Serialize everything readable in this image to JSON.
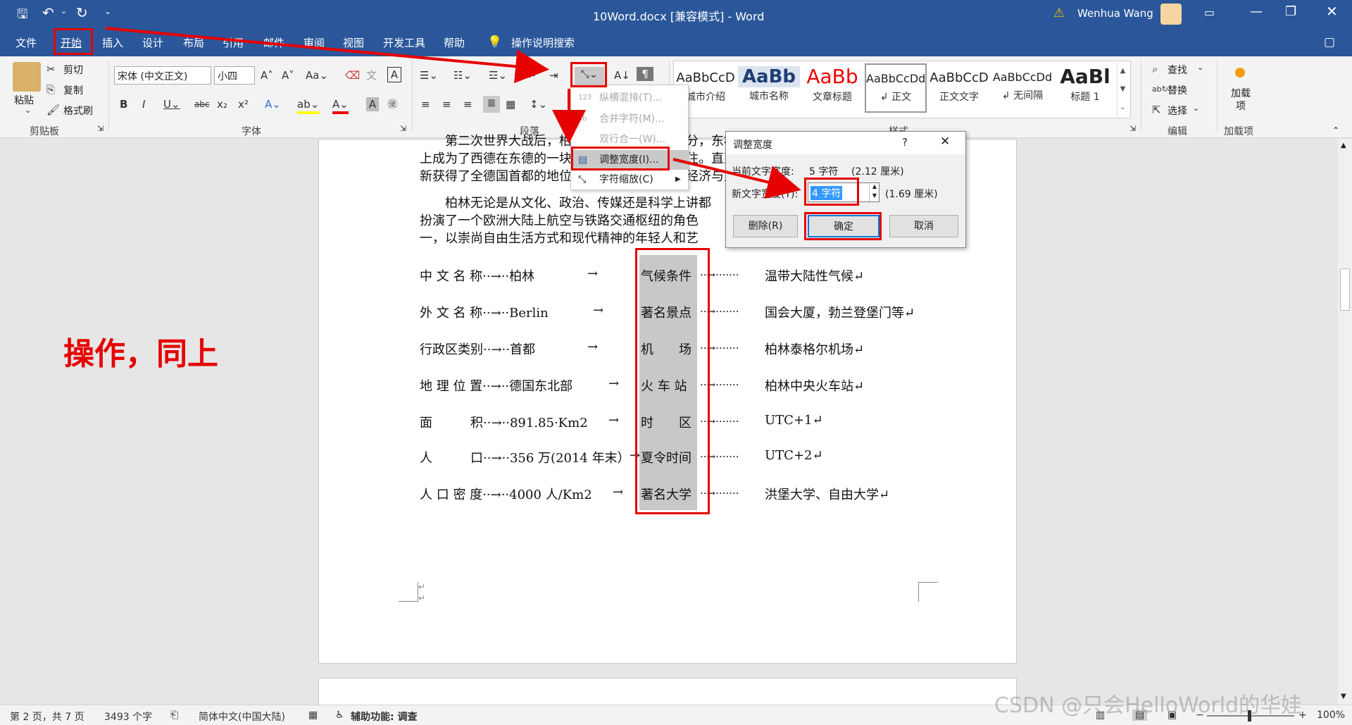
{
  "titlebar": {
    "doc_title": "10Word.docx [兼容模式] - Word",
    "user_name": "Wenhua Wang"
  },
  "tabs": [
    "文件",
    "开始",
    "插入",
    "设计",
    "布局",
    "引用",
    "邮件",
    "审阅",
    "视图",
    "开发工具",
    "帮助"
  ],
  "tell_me": "操作说明搜索",
  "clipboard": {
    "paste": "粘贴",
    "cut": "剪切",
    "copy": "复制",
    "format_painter": "格式刷",
    "group_label": "剪贴板"
  },
  "font": {
    "font_name": "宋体 (中文正文)",
    "font_size": "小四",
    "group_label": "字体"
  },
  "paragraph": {
    "group_label": "段落"
  },
  "styles": {
    "group_label": "样式",
    "items": [
      {
        "preview": "AaBbCcD",
        "name": "城市介绍"
      },
      {
        "preview": "AaBb",
        "name": "城市名称"
      },
      {
        "preview": "AaBb",
        "name": "文章标题"
      },
      {
        "preview": "AaBbCcDd",
        "name": "↲ 正文"
      },
      {
        "preview": "AaBbCcD",
        "name": "正文文字"
      },
      {
        "preview": "AaBbCcDd",
        "name": "↲ 无间隔"
      },
      {
        "preview": "AaBl",
        "name": "标题 1"
      }
    ]
  },
  "editing": {
    "find": "查找",
    "replace": "替换",
    "select": "选择",
    "group_label": "编辑"
  },
  "addins": {
    "label": "加载项",
    "group_label": "加载项"
  },
  "menu": {
    "items": [
      "纵横混排(T)...",
      "合并字符(M)...",
      "双行合一(W)...",
      "调整宽度(I)...",
      "字符缩放(C)"
    ]
  },
  "dialog": {
    "title": "调整宽度",
    "help": "?",
    "current_label": "当前文字宽度:",
    "current_value": "5 字符",
    "current_cm": "(2.12 厘米)",
    "new_label": "新文字宽度(T):",
    "new_value": "4 字符",
    "new_cm": "(1.69 厘米)",
    "delete_btn": "删除(R)",
    "ok_btn": "确定",
    "cancel_btn": "取消"
  },
  "document": {
    "para_lines": [
      "　　第二次世界大战后，柏林被分割为东西两部分，东柏林成为东德首都，而西柏林",
      "上成为了西德在东德的一块飞地，被柏林墙所围住。直到1990年两德统一，柏林",
      "新获得了全德国首都的地位，成为德国的政治、经济与文化中心。",
      "　　柏林无论是从文化、政治、传媒还是科学上讲都",
      "扮演了一个欧洲大陆上航空与铁路交通枢纽的角色",
      "一，以崇尚自由生活方式和现代精神的年轻人和艺"
    ],
    "table_rows": [
      {
        "label": "中 文 名 称··→··柏林",
        "arrow": "→",
        "mid": "气候条件",
        "right": "温带大陆性气候↵"
      },
      {
        "label": "外 文 名 称··→··Berlin",
        "arrow": "→",
        "mid": "著名景点",
        "right": "国会大厦，勃兰登堡门等↵"
      },
      {
        "label": "行政区类别··→··首都",
        "arrow": "→",
        "mid": "机　　场",
        "right": "柏林泰格尔机场↵"
      },
      {
        "label": "地 理 位 置··→··德国东北部",
        "arrow": "→",
        "mid": "火 车 站",
        "right": "柏林中央火车站↵"
      },
      {
        "label": "面　　　积··→··891.85·Km2",
        "arrow": "→",
        "mid": "时　　区",
        "right": "UTC+1↵"
      },
      {
        "label": "人　　　口··→··356 万(2014 年末）",
        "arrow": "→",
        "mid": "夏令时间",
        "right": "UTC+2↵"
      },
      {
        "label": "人 口 密 度··→··4000 人/Km2",
        "arrow": "→",
        "mid": "著名大学",
        "right": "洪堡大学、自由大学↵"
      }
    ],
    "dots": "··→·······",
    "paragraph_mark": "↵"
  },
  "annotation": "操作，同上",
  "statusbar": {
    "page": "第 2 页，共 7 页",
    "words": "3493 个字",
    "lang": "简体中文(中国大陆)",
    "accessibility": "辅助功能: 调查",
    "zoom": "100%"
  },
  "watermark": "CSDN @只会HelloWorld的华娃",
  "colors": {
    "title_blue": "#2b579a",
    "annotation_red": "#e60000"
  }
}
